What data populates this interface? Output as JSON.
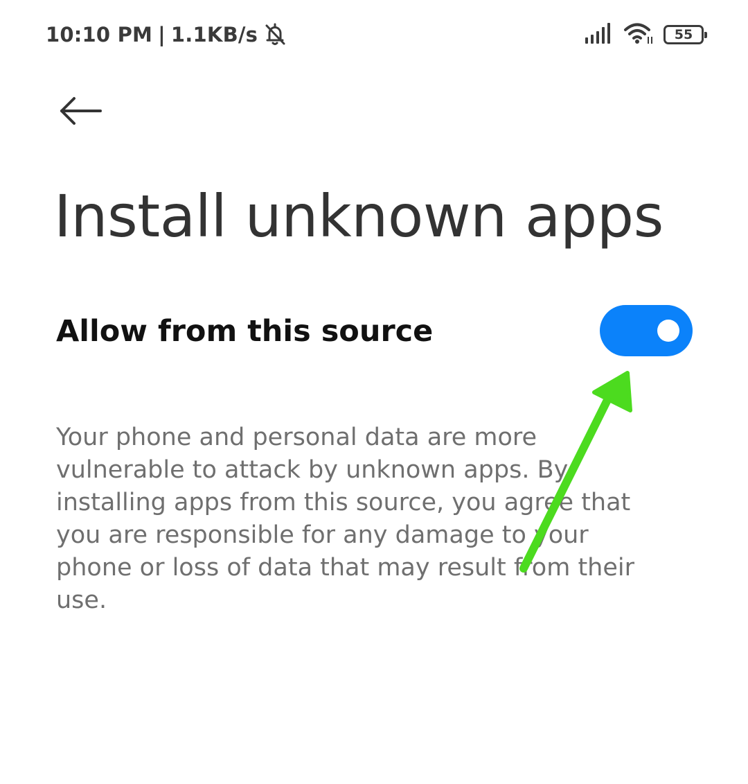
{
  "status_bar": {
    "time": "10:10 PM",
    "separator": "|",
    "network_speed": "1.1KB/s",
    "battery_level": "55",
    "icons": [
      "bell-off-icon",
      "signal-icon",
      "wifi-icon",
      "battery-icon"
    ]
  },
  "header": {
    "back_icon": "arrow-left-icon",
    "title": "Install unknown apps"
  },
  "setting": {
    "label": "Allow from this source",
    "toggle_state": "on",
    "toggle_color": "#0b82fa"
  },
  "description": "Your phone and personal data are more vulnerable to attack by unknown apps. By installing apps from this source, you agree that you are responsible for any damage to your phone or loss of data that may result from their use.",
  "annotation": {
    "icon": "green-arrow-icon",
    "color": "#4cdb1f"
  }
}
